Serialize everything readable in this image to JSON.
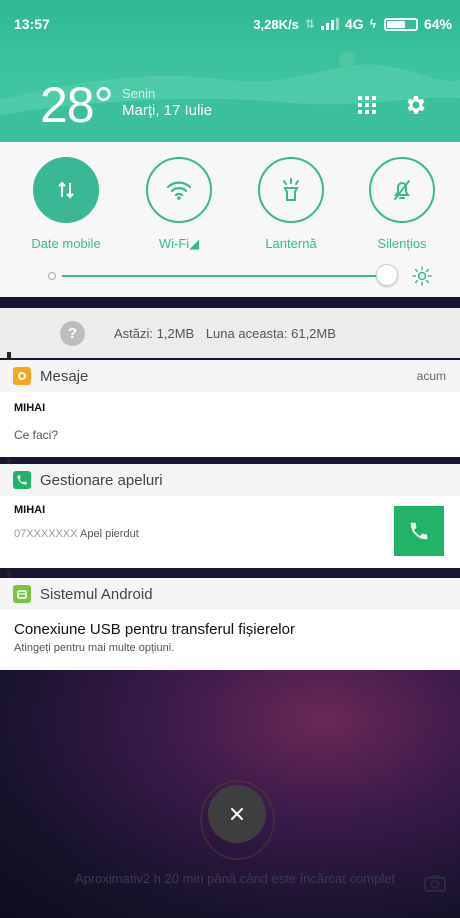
{
  "status_bar": {
    "time": "13:57",
    "speed": "3,28K/s",
    "network": "4G",
    "battery": "64%",
    "battery_level": 0.64
  },
  "header": {
    "temperature": "28°",
    "day": "Senin",
    "date": "Marți, 17 Iulie"
  },
  "quick_toggles": [
    {
      "label": "Date mobile",
      "active": true,
      "icon": "mobile-data-icon"
    },
    {
      "label": "Wi-Fi◢",
      "active": false,
      "icon": "wifi-icon"
    },
    {
      "label": "Lanternă",
      "active": false,
      "icon": "flashlight-icon"
    },
    {
      "label": "Silențios",
      "active": false,
      "icon": "bell-off-icon"
    }
  ],
  "brightness": {
    "level": 0.95
  },
  "data_usage": {
    "today": "Astăzi: 1,2MB",
    "month": "Luna aceasta: 61,2MB"
  },
  "notifications": [
    {
      "app": "Mesaje",
      "time": "acum",
      "title": "MIHAI",
      "text": "Ce faci?",
      "icon_color": "#f5a623"
    },
    {
      "app": "Gestionare apeluri",
      "title": "MIHAI",
      "number": "07XXXXXXX",
      "text": "Apel pierdut",
      "icon_color": "#22b368"
    },
    {
      "app": "Sistemul Android",
      "title": "Conexiune USB pentru transferul fișierelor",
      "text": "Atingeți pentru mai multe opțiuni.",
      "icon_color": "#7cc242"
    }
  ],
  "charging": {
    "text": "Aproximativ2 h 20 min până când este încărcat complet"
  },
  "colors": {
    "accent": "#3ab794",
    "call": "#22b368"
  }
}
